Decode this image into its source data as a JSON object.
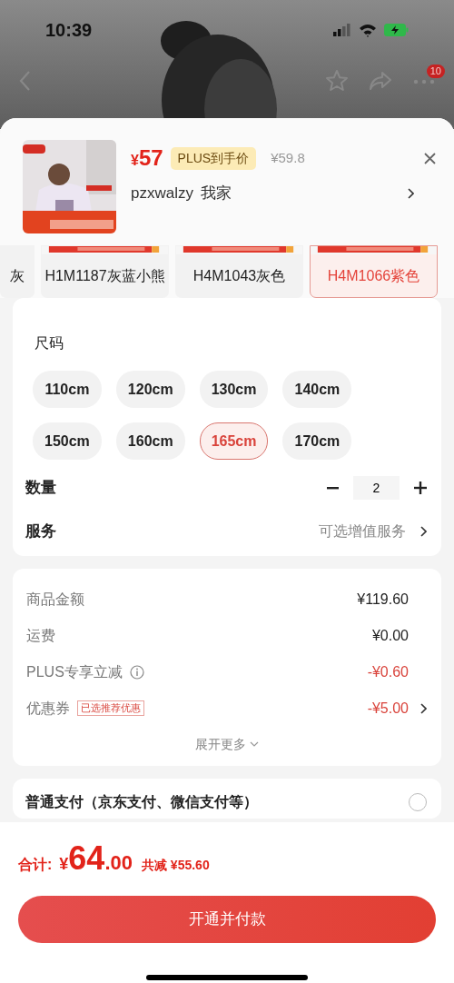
{
  "status_bar": {
    "time": "10:39"
  },
  "nav": {
    "badge": "10"
  },
  "product": {
    "currency": "¥",
    "price": "57",
    "plus_label": "PLUS到手价",
    "original_price": "¥59.8",
    "shop": "pzxwalzy",
    "shop_suffix": "我家"
  },
  "colors": [
    {
      "label": "灰",
      "selected": false
    },
    {
      "label": "H1M1187灰蓝小熊",
      "selected": false
    },
    {
      "label": "H4M1043灰色",
      "selected": false
    },
    {
      "label": "H4M1066紫色",
      "selected": true
    }
  ],
  "size": {
    "title": "尺码",
    "options": [
      {
        "label": "110cm",
        "selected": false
      },
      {
        "label": "120cm",
        "selected": false
      },
      {
        "label": "130cm",
        "selected": false
      },
      {
        "label": "140cm",
        "selected": false
      },
      {
        "label": "150cm",
        "selected": false
      },
      {
        "label": "160cm",
        "selected": false
      },
      {
        "label": "165cm",
        "selected": true
      },
      {
        "label": "170cm",
        "selected": false
      }
    ]
  },
  "quantity": {
    "label": "数量",
    "value": "2"
  },
  "service": {
    "label": "服务",
    "value": "可选增值服务"
  },
  "summary": {
    "rows": [
      {
        "kind": "plain",
        "label": "商品金额",
        "value": "¥119.60",
        "info": false,
        "link": false
      },
      {
        "kind": "plain",
        "label": "运费",
        "value": "¥0.00",
        "info": false,
        "link": false
      },
      {
        "kind": "discount",
        "label": "PLUS专享立减",
        "value": "-¥0.60",
        "info": true,
        "link": false
      },
      {
        "kind": "discount",
        "label": "优惠券",
        "tag": "已选推荐优惠",
        "value": "-¥5.00",
        "info": false,
        "link": true
      }
    ],
    "more": "展开更多"
  },
  "payment": {
    "label": "普通支付（京东支付、微信支付等）",
    "selected": false
  },
  "footer": {
    "total_label": "合计:",
    "currency": "¥",
    "total_int": "64",
    "total_dec": ".00",
    "saved": "共减 ¥55.60",
    "button": "开通并付款"
  }
}
